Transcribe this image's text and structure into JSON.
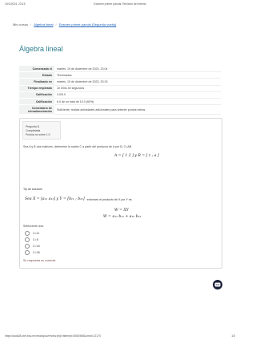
{
  "print_header": {
    "datetime": "19/1/2024, 23:15",
    "page_title": "Examen primer parcial: Revisión del intento"
  },
  "breadcrumb": {
    "items": [
      "Mis cursos",
      "Álgebra lineal",
      "Examen primer parcial (Segunda vuelta)"
    ]
  },
  "page_title": "Álgebra lineal",
  "summary": [
    {
      "label": "Comenzado el",
      "value": "martes, 19 de diciembre de 2023, 23:04"
    },
    {
      "label": "Estado",
      "value": "Terminados"
    },
    {
      "label": "Finalizado en",
      "value": "martes, 19 de diciembre de 2023, 23:15"
    },
    {
      "label": "Tiempo empleado",
      "value": "10 mins 40 segundos"
    },
    {
      "label": "Calificación",
      "value": "3.0/5.0"
    },
    {
      "label": "Calificación",
      "value": "6.0 de un total de 10.0 (60%)"
    },
    {
      "label": "Comentario de retroalimentación",
      "value": "Suficiente, realiza actividades adicionales para obtener puntos extras"
    }
  ],
  "question": {
    "label": "Pregunta",
    "number": "1",
    "status": "Completada",
    "score": "Puntúa no sobre 1.0",
    "text": "Sea A y B dos matrices, determine la matriz C a partir del producto de A por B, C=AB",
    "formula_a": "A = [ 1  2 ] y B = [ z ; a ]",
    "hint_label": "Tip de solución",
    "hint_prefix": "Sea",
    "hint_x": "Sea X = [a₁₁  a₁₂] y Y = [b₁₁ ; b₂₁]",
    "hint_mid": "entonces el producto de X por Y es",
    "formula_w1": "W = XY",
    "formula_w2": "W = a₁₁ b₁₁ + a₁₂ b₂₁",
    "select_label": "Seleccione una:",
    "options": [
      "C=11",
      "C=5",
      "C=16",
      "C=26"
    ],
    "feedback": "Su respuesta es correcta."
  },
  "print_footer": {
    "url": "https://aula28.utel.edu.mx/mod/quiz/review.php?attempt=8051968&cmid=12170",
    "page": "1/3"
  },
  "colors": {
    "accent": "#2d7d8e",
    "link": "#1f62b8",
    "chat": "#1a1f3a"
  }
}
